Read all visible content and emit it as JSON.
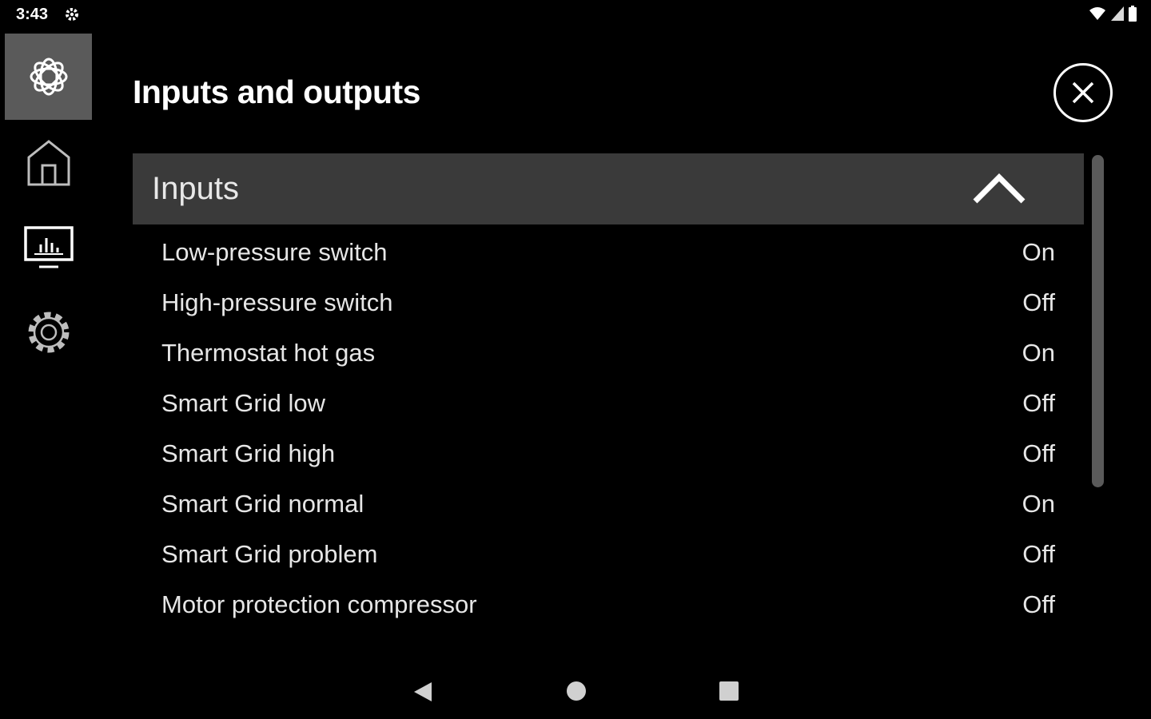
{
  "status_bar": {
    "time": "3:43",
    "left_icon": "gear-icon",
    "right_icons": [
      "wifi-icon",
      "signal-icon",
      "battery-icon"
    ]
  },
  "side_nav": {
    "items": [
      {
        "icon": "app-logo-icon",
        "active": true
      },
      {
        "icon": "home-icon",
        "active": false
      },
      {
        "icon": "monitor-chart-icon",
        "active": false
      },
      {
        "icon": "gear-icon",
        "active": false
      }
    ]
  },
  "header": {
    "title": "Inputs and outputs",
    "close_icon": "close-icon"
  },
  "inputs_section": {
    "title": "Inputs",
    "expanded": true,
    "rows": [
      {
        "label": "Low-pressure switch",
        "value": "On"
      },
      {
        "label": "High-pressure switch",
        "value": "Off"
      },
      {
        "label": "Thermostat hot gas",
        "value": "On"
      },
      {
        "label": "Smart Grid low",
        "value": "Off"
      },
      {
        "label": "Smart Grid high",
        "value": "Off"
      },
      {
        "label": "Smart Grid normal",
        "value": "On"
      },
      {
        "label": "Smart Grid problem",
        "value": "Off"
      },
      {
        "label": "Motor protection compressor",
        "value": "Off"
      }
    ]
  },
  "nav_bar": {
    "icons": [
      "back-icon",
      "home-circle-icon",
      "recents-icon"
    ]
  },
  "colors": {
    "background": "#000000",
    "section_header": "#3a3a3a",
    "active_nav": "#5a5a5a",
    "text": "#e6e6e6"
  }
}
